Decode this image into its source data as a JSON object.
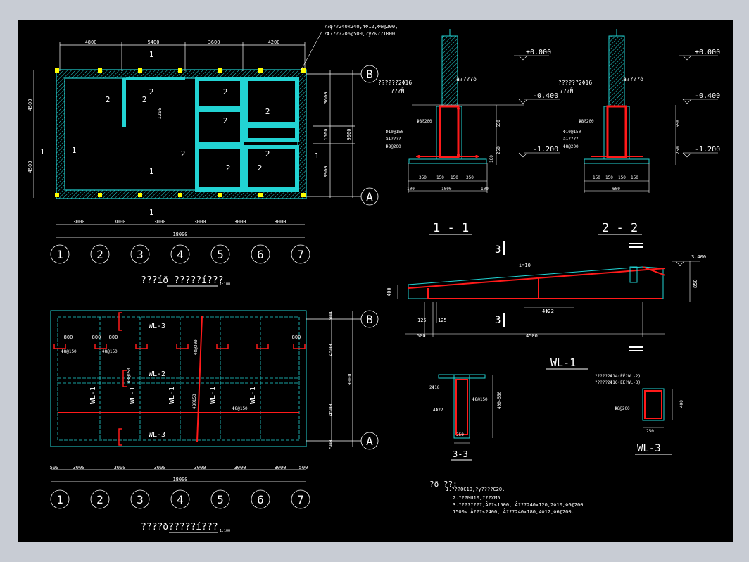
{
  "plan_foundation": {
    "col_dims_top": [
      "4800",
      "5400",
      "3600",
      "4200"
    ],
    "col_dims_bottom": [
      "3000",
      "3000",
      "3000",
      "3000",
      "3000",
      "3000"
    ],
    "total_width": "18000",
    "row_dims_left": [
      "4500",
      "4500"
    ],
    "row_dims_right": [
      "3600",
      "1500",
      "3900"
    ],
    "total_height": "9000",
    "axis_numbers": [
      "1",
      "2",
      "3",
      "4",
      "5",
      "6",
      "7"
    ],
    "axis_letters": [
      "B",
      "A"
    ],
    "note_top": "??φ??240x240,4Φ12,Φ6@200,",
    "note_top2": "?Φ????2Φ6@500,?y?&??1000",
    "title": "???íð ?????í???",
    "scale": "1:100",
    "section_mark": "1",
    "section_mark2": "2",
    "dim_1200": "1200"
  },
  "plan_roof": {
    "col_dims_bottom": [
      "500",
      "3000",
      "3000",
      "3000",
      "3000",
      "3000",
      "3000",
      "500"
    ],
    "total_width": "18000",
    "row_dims_right": [
      "500",
      "4500",
      "4500",
      "500"
    ],
    "total_height": "9000",
    "beams": [
      "WL-3",
      "WL-2",
      "WL-3"
    ],
    "beams_v": [
      "WL-1",
      "WL-1",
      "WL-1",
      "WL-1",
      "WL-1"
    ],
    "rebar": [
      "Φ8@150",
      "Φ8@150",
      "Φ8@150",
      "Φ8@150",
      "Φ8@200",
      "Φ8@150"
    ],
    "dim_800": "800",
    "title": "????ð?????í???",
    "scale": "1:100"
  },
  "section_11": {
    "title": "1 - 1",
    "elev": [
      "±0.000",
      "-0.400",
      "-1.200"
    ],
    "note1": "??????2Φ16",
    "note2": "???Ñ",
    "note3": "à????ò",
    "rebar": [
      "Φ8@200",
      "Φ10@150",
      "à1????",
      "Φ8@200"
    ],
    "dims_v": [
      "550",
      "250",
      "100"
    ],
    "dims_h": [
      "350",
      "150",
      "150",
      "350"
    ],
    "width": "1000",
    "edge": [
      "100",
      "100"
    ]
  },
  "section_22": {
    "title": "2 - 2",
    "elev": [
      "±0.000",
      "-0.400",
      "-1.200"
    ],
    "dims_h": [
      "150",
      "150",
      "150",
      "150"
    ],
    "width": "600"
  },
  "wl1": {
    "title": "WL-1",
    "slope": "i=10",
    "elev": "3.400",
    "dims": [
      "500",
      "4500",
      "125",
      "125",
      "400",
      "850"
    ],
    "rebar": "4Φ22",
    "mark": "3"
  },
  "sec33": {
    "title": "3-3",
    "labels": [
      "2Φ18",
      "Φ8@150",
      "4Φ22",
      "400-550",
      "250"
    ]
  },
  "wl3": {
    "title": "WL-3",
    "labels": [
      "?????2Φ14(ÉÊ?WL-2)",
      "?????2Φ16(ÉÊ?WL-3)",
      "Φ6@200",
      "400",
      "250"
    ]
  },
  "notes": {
    "heading": "?ð  ??:",
    "lines": [
      "1.???ÓC10,?y????C20.",
      "2.???MU10,???XM5.",
      "3.????????,Â??<1500, Â???240x120,2Φ10,Φ6@200.",
      "  1500< Â???<2400, Â???240x180,4Φ12,Φ6@200."
    ]
  },
  "colors": {
    "wall": "#22d3d3",
    "column": "#ffff00",
    "red": "#ff1a1a",
    "dim": "#ffffff",
    "bg": "#000000"
  }
}
